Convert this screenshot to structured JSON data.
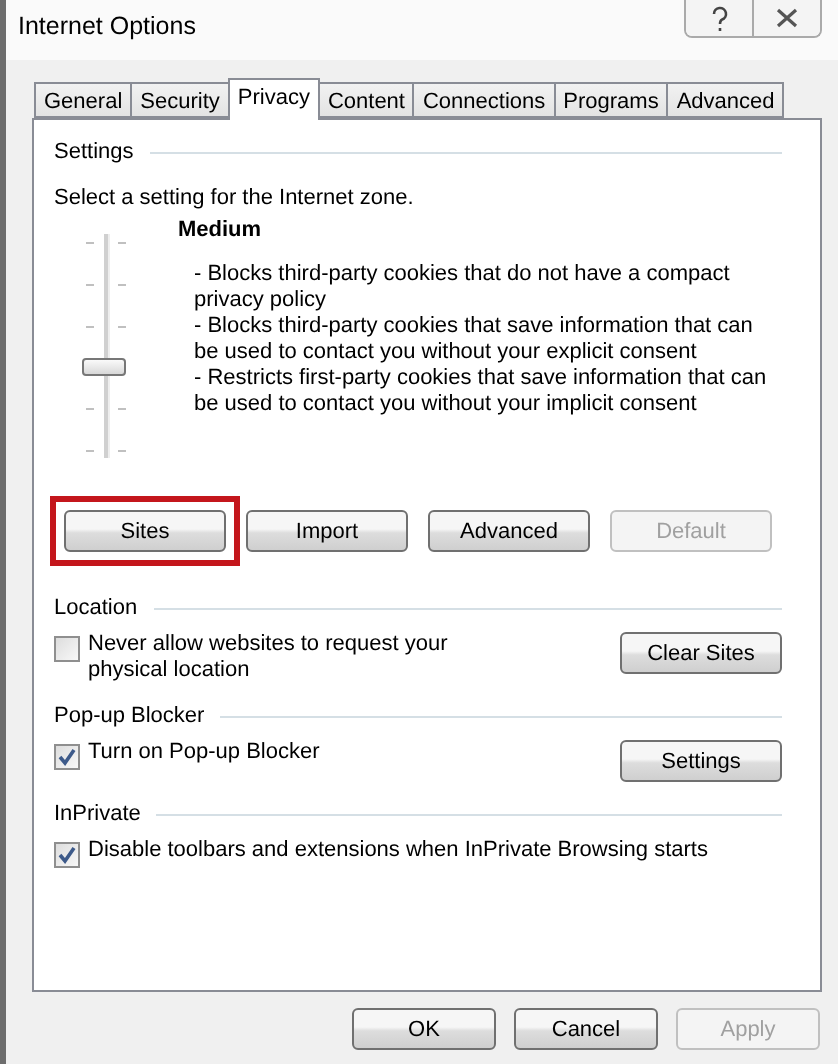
{
  "window": {
    "title": "Internet Options"
  },
  "tabs": [
    {
      "label": "General",
      "selected": false
    },
    {
      "label": "Security",
      "selected": false
    },
    {
      "label": "Privacy",
      "selected": true
    },
    {
      "label": "Content",
      "selected": false
    },
    {
      "label": "Connections",
      "selected": false
    },
    {
      "label": "Programs",
      "selected": false
    },
    {
      "label": "Advanced",
      "selected": false
    }
  ],
  "settings": {
    "heading": "Settings",
    "prompt": "Select a setting for the Internet zone.",
    "slider": {
      "level": 0.4
    },
    "level_name": "Medium",
    "description": [
      "- Blocks third-party cookies that do not have a compact privacy policy",
      "- Blocks third-party cookies that save information that can be used to contact you without your explicit consent",
      "- Restricts first-party cookies that save information that can be used to contact you without your implicit consent"
    ],
    "buttons": [
      {
        "label": "Sites",
        "disabled": false,
        "highlighted": true
      },
      {
        "label": "Import",
        "disabled": false,
        "highlighted": false
      },
      {
        "label": "Advanced",
        "disabled": false,
        "highlighted": false
      },
      {
        "label": "Default",
        "disabled": true,
        "highlighted": false
      }
    ]
  },
  "sections": [
    {
      "heading": "Location",
      "checkbox": {
        "label": "Never allow websites to request your physical location",
        "checked": false
      },
      "button": {
        "label": "Clear Sites"
      }
    },
    {
      "heading": "Pop-up Blocker",
      "checkbox": {
        "label": "Turn on Pop-up Blocker",
        "checked": true
      },
      "button": {
        "label": "Settings"
      }
    },
    {
      "heading": "InPrivate",
      "checkbox": {
        "label": "Disable toolbars and extensions when InPrivate Browsing starts",
        "checked": true
      }
    }
  ],
  "footer_buttons": [
    {
      "label": "OK",
      "disabled": false
    },
    {
      "label": "Cancel",
      "disabled": false
    },
    {
      "label": "Apply",
      "disabled": true
    }
  ]
}
